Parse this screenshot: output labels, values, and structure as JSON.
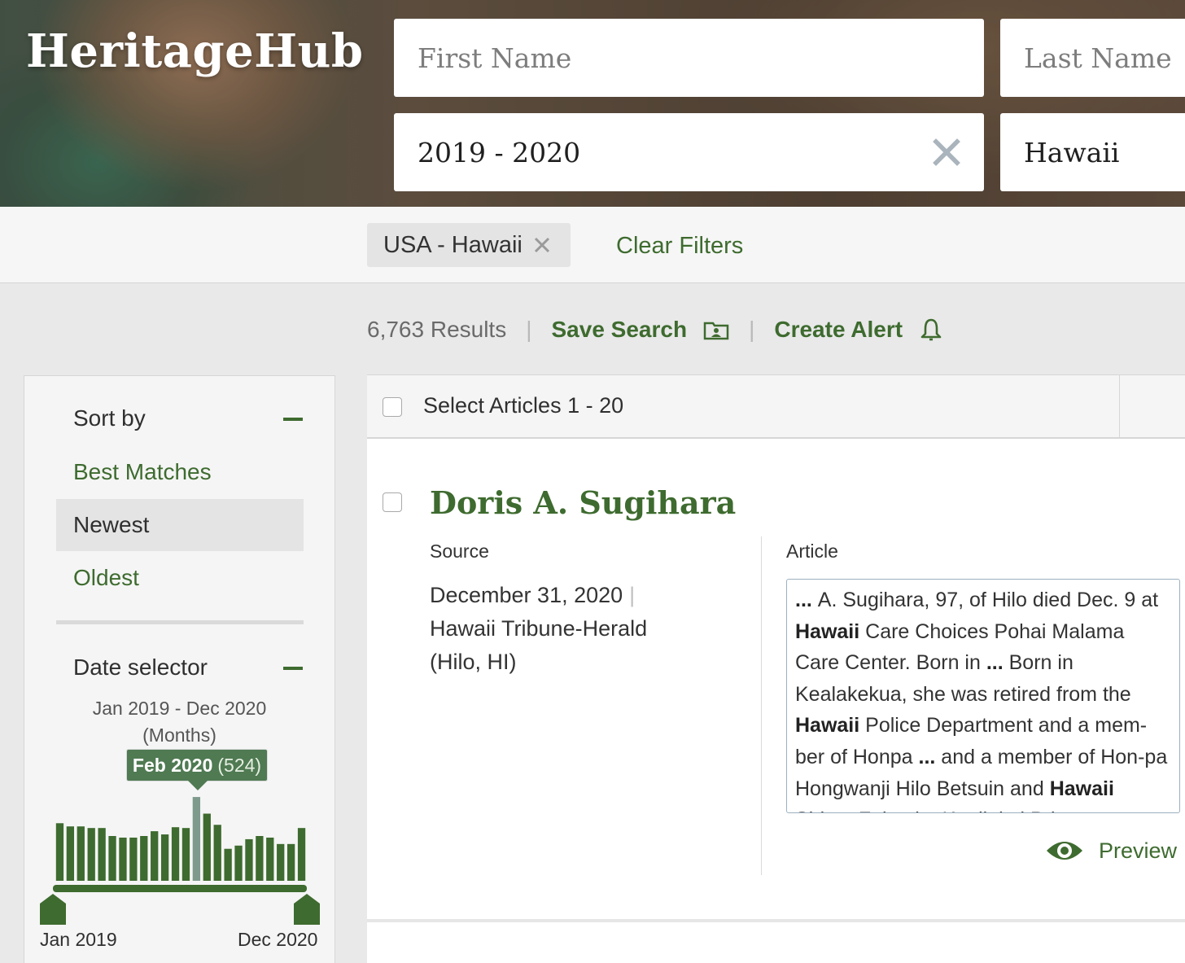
{
  "brand": {
    "logo_text": "HeritageHub"
  },
  "search": {
    "first_name_placeholder": "First Name",
    "last_name_placeholder": "Last Name",
    "date_value": "2019 - 2020",
    "place_value": "Hawaii"
  },
  "filters": {
    "chip_label": "USA - Hawaii",
    "clear_label": "Clear Filters"
  },
  "results": {
    "count_label": "6,763 Results",
    "save_search_label": "Save Search",
    "create_alert_label": "Create Alert"
  },
  "sidebar": {
    "sort_title": "Sort by",
    "sort_options": [
      "Best Matches",
      "Newest",
      "Oldest"
    ],
    "selected_sort": "Newest",
    "date_title": "Date selector",
    "date_range_line1": "Jan 2019 - Dec 2020",
    "date_range_line2": "(Months)",
    "tooltip_month": "Feb 2020",
    "tooltip_count": "(524)",
    "start_label": "Jan 2019",
    "end_label": "Dec 2020"
  },
  "chart_data": {
    "type": "bar",
    "categories": [
      "Jan 2019",
      "Feb 2019",
      "Mar 2019",
      "Apr 2019",
      "May 2019",
      "Jun 2019",
      "Jul 2019",
      "Aug 2019",
      "Sep 2019",
      "Oct 2019",
      "Nov 2019",
      "Dec 2019",
      "Jan 2020",
      "Feb 2020",
      "Mar 2020",
      "Apr 2020",
      "May 2020",
      "Jun 2020",
      "Jul 2020",
      "Aug 2020",
      "Sep 2020",
      "Oct 2020",
      "Nov 2020",
      "Dec 2020"
    ],
    "values": [
      360,
      340,
      340,
      330,
      330,
      280,
      270,
      270,
      280,
      310,
      290,
      335,
      330,
      524,
      420,
      350,
      200,
      220,
      260,
      280,
      270,
      230,
      230,
      330
    ],
    "highlighted": "Feb 2020",
    "colors": {
      "bar": "#3e6b2f",
      "highlight": "#7e9a8c"
    }
  },
  "list": {
    "select_label": "Select Articles 1 - 20",
    "articles": [
      {
        "title": "Doris A. Sugihara",
        "source_label": "Source",
        "article_label": "Article",
        "date": "December 31, 2020",
        "source_pipe": "|",
        "source_name": "Hawaii Tribune-Herald",
        "source_place": "(Hilo, HI)",
        "snippet": [
          {
            "t": "... ",
            "b": true
          },
          {
            "t": "A. Sugihara, 97, of Hilo died Dec. 9 at ",
            "b": false
          },
          {
            "t": "Hawaii",
            "b": true
          },
          {
            "t": " Care Choices Pohai Malama Care Center. Born in ",
            "b": false
          },
          {
            "t": "...",
            "b": true
          },
          {
            "t": " Born in Kealakekua, she was retired from the ",
            "b": false
          },
          {
            "t": "Hawaii",
            "b": true
          },
          {
            "t": " Police Department and a mem-ber of Honpa ",
            "b": false
          },
          {
            "t": "...",
            "b": true
          },
          {
            "t": " and a member of Hon-pa Hongwanji Hilo Betsuin and ",
            "b": false
          },
          {
            "t": "Hawaii",
            "b": true
          },
          {
            "t": " Shima Fukuoka Kenjinkai Prin-",
            "b": false
          }
        ],
        "preview_label": "Preview"
      }
    ]
  },
  "icons": [
    "clear-x-icon",
    "close-icon",
    "folder-user-icon",
    "bell-icon",
    "eye-icon",
    "minus-icon",
    "slider-handle-icon",
    "checkbox-icon"
  ],
  "accent_color": "#3e6b2f"
}
